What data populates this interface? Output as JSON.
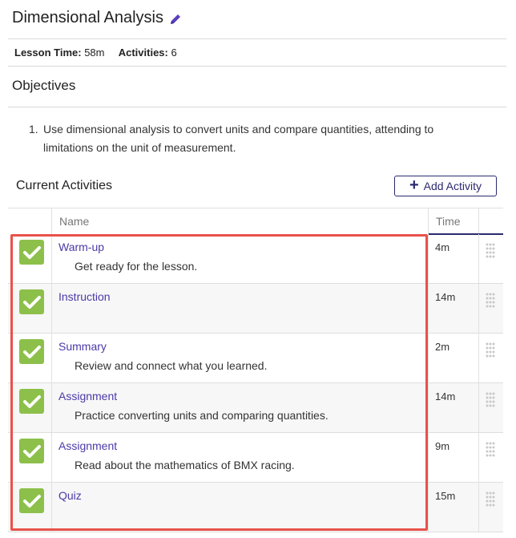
{
  "lesson": {
    "title": "Dimensional Analysis",
    "edit_icon": "pencil-icon",
    "time_label": "Lesson Time:",
    "time_value": "58m",
    "activities_label": "Activities:",
    "activities_value": "6"
  },
  "objectives": {
    "title": "Objectives",
    "items": [
      {
        "num": "1.",
        "text": "Use dimensional analysis to convert units and compare quantities, attending to limitations on the unit of measurement."
      }
    ]
  },
  "current_activities": {
    "title": "Current Activities",
    "add_button": "Add Activity",
    "columns": {
      "name": "Name",
      "time": "Time"
    },
    "rows": [
      {
        "name": "Warm-up",
        "description": "Get ready for the lesson.",
        "time": "4m",
        "checked": true
      },
      {
        "name": "Instruction",
        "description": "",
        "time": "14m",
        "checked": true
      },
      {
        "name": "Summary",
        "description": "Review and connect what you learned.",
        "time": "2m",
        "checked": true
      },
      {
        "name": "Assignment",
        "description": "Practice converting units and comparing quantities.",
        "time": "14m",
        "checked": true
      },
      {
        "name": "Assignment",
        "description": "Read about the mathematics of BMX racing.",
        "time": "9m",
        "checked": true
      },
      {
        "name": "Quiz",
        "description": "",
        "time": "15m",
        "checked": true
      }
    ]
  },
  "colors": {
    "accent": "#2b2a6e",
    "link": "#4a3aa8",
    "check": "#8cc04a",
    "highlight": "#e8524a"
  }
}
